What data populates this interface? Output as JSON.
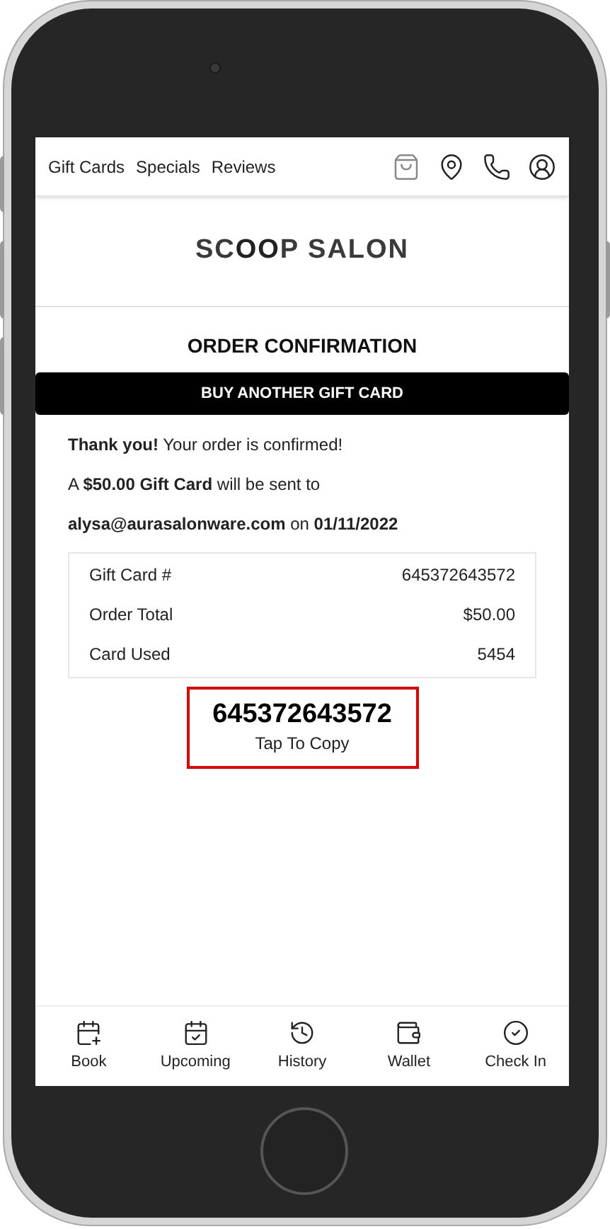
{
  "nav": {
    "links": [
      "Gift Cards",
      "Specials",
      "Reviews"
    ]
  },
  "logo": "SC**OO**P SALON",
  "page_title": "ORDER CONFIRMATION",
  "buy_button": "BUY ANOTHER GIFT CARD",
  "messages": [
    "**Thank you!** Your order is confirmed!",
    "A **$50.00 Gift Card** will be sent to",
    "**alysa@aurasalonware.com** on **01/11/2022**"
  ],
  "summary": [
    {
      "label": "Gift Card #",
      "value": "645372643572"
    },
    {
      "label": "Order Total",
      "value": "$50.00"
    },
    {
      "label": "Card Used",
      "value": "5454"
    }
  ],
  "copy_box": {
    "code": "645372643572",
    "hint": "Tap To Copy"
  },
  "tab_bar": [
    {
      "kind": "book",
      "label": "Book"
    },
    {
      "kind": "upcoming",
      "label": "Upcoming"
    },
    {
      "kind": "history",
      "label": "History"
    },
    {
      "kind": "wallet",
      "label": "Wallet"
    },
    {
      "kind": "checkin",
      "label": "Check In"
    }
  ]
}
